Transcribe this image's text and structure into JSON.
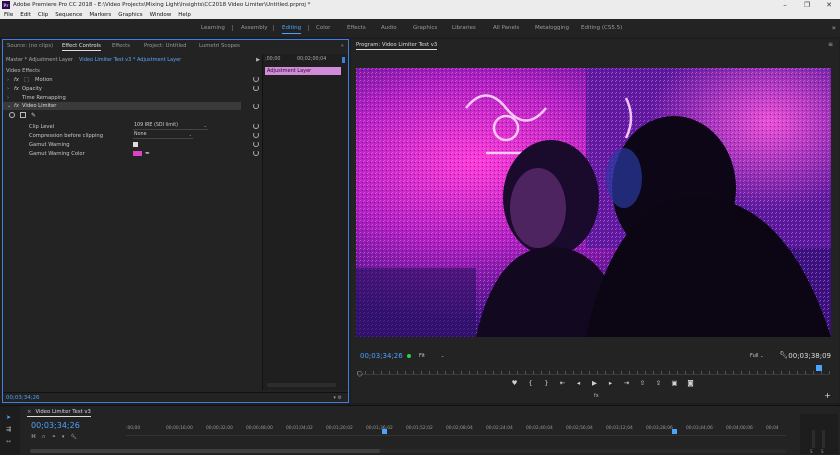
{
  "window": {
    "title": "Adobe Premiere Pro CC 2018 - E:\\Video Projects\\Mixing Light\\Insights\\CC2018 Video Limiter\\Untitled.prproj *",
    "app_icon": "Pr",
    "controls": [
      "–",
      "❐",
      "✕"
    ]
  },
  "menu": [
    "File",
    "Edit",
    "Clip",
    "Sequence",
    "Markers",
    "Graphics",
    "Window",
    "Help"
  ],
  "workspaces": {
    "items": [
      "Learning",
      "Assembly",
      "Editing",
      "Color",
      "Effects",
      "Audio",
      "Graphics",
      "Libraries",
      "All Panels",
      "Metalogging",
      "Editing (CS5.5)"
    ],
    "active": "Editing",
    "more": "»"
  },
  "effect_controls": {
    "tabs": [
      "Source: (no clips)",
      "Effect Controls",
      "Effects",
      "Project: Untitled",
      "Lumetri Scopes"
    ],
    "active_tab": "Effect Controls",
    "more": "»",
    "master_label": "Master * Adjustment Layer",
    "clip_label": "Video Limiter Test v3 * Adjustment Layer",
    "section": "Video Effects",
    "effects": {
      "motion": "Motion",
      "opacity": "Opacity",
      "time_remapping": "Time Remapping",
      "video_limiter": "Video Limiter"
    },
    "fx_badge": "fx",
    "params": {
      "clip_level_label": "Clip Level",
      "clip_level_value": "109 IRE (SDI limit)",
      "compression_label": "Compression before clipping",
      "compression_value": "None",
      "gamut_warning_label": "Gamut Warning",
      "gamut_warning_color_label": "Gamut Warning Color"
    },
    "gamut_color": "#e040c8",
    "timeline_ruler": [
      ";00;00",
      "00;02;00;04"
    ],
    "adjustment_bar": "Adjustment Layer",
    "timecode": "00;03;34;26"
  },
  "program": {
    "title": "Program: Video Limiter Test v3",
    "more": "≡",
    "timecode": "00;03;34;26",
    "fit": "Fit",
    "quality": "Full",
    "duration": "00;03;38;09",
    "fx": "fx",
    "add": "+"
  },
  "timeline": {
    "tab": "Video Limiter Test v3",
    "close": "×",
    "timecode": "00;03;34;26",
    "ruler": [
      ":00;00",
      "00;00;16;00",
      "00;00;32;00",
      "00;00;48;00",
      "00;01;04;02",
      "00;01;20;02",
      "00;01;36;02",
      "00;01;52;02",
      "00;02;08;04",
      "00;02;24;04",
      "00;02;40;04",
      "00;02;56;04",
      "00;03;12;04",
      "00;03;28;06",
      "00;03;44;06",
      "00;04;00;06",
      "00;04"
    ],
    "meter_labels": [
      "S",
      "S"
    ]
  },
  "colors": {
    "accent": "#4aa3ff",
    "adjustment_layer": "#d08cd8"
  }
}
